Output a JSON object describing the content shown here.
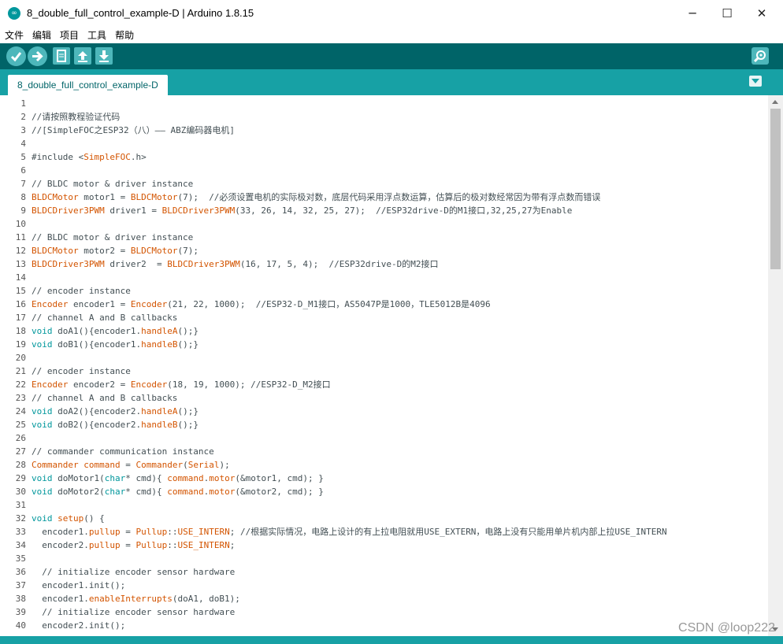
{
  "window": {
    "title": "8_double_full_control_example-D | Arduino 1.8.15",
    "app_icon": "∞",
    "minimize": "─",
    "maximize": "☐",
    "close": "✕"
  },
  "menu": [
    "文件",
    "编辑",
    "项目",
    "工具",
    "帮助"
  ],
  "toolbar": {
    "verify": "verify-icon",
    "upload": "upload-icon",
    "new": "new-file-icon",
    "open": "open-file-icon",
    "save": "save-file-icon",
    "serial_monitor": "serial-monitor-icon"
  },
  "tab": {
    "label": "8_double_full_control_example-D"
  },
  "watermark": "CSDN @loop222",
  "colors": {
    "toolbar": "#006468",
    "tabbar": "#17a1a5",
    "keyword": "#00979c",
    "type": "#d35400"
  },
  "code_lines": [
    {
      "n": "1",
      "parts": []
    },
    {
      "n": "2",
      "parts": [
        [
          "c",
          "//请按照教程验证代码"
        ]
      ]
    },
    {
      "n": "3",
      "parts": [
        [
          "c",
          "//[SimpleFOC之ESP32（八）—— ABZ编码器电机]"
        ]
      ]
    },
    {
      "n": "4",
      "parts": []
    },
    {
      "n": "5",
      "parts": [
        [
          "c",
          "#include <"
        ],
        [
          "t",
          "SimpleFOC"
        ],
        [
          "c",
          ".h>"
        ]
      ]
    },
    {
      "n": "6",
      "parts": []
    },
    {
      "n": "7",
      "parts": [
        [
          "c",
          "// BLDC motor & driver instance"
        ]
      ]
    },
    {
      "n": "8",
      "parts": [
        [
          "t",
          "BLDCMotor"
        ],
        [
          "c",
          " motor1 = "
        ],
        [
          "t",
          "BLDCMotor"
        ],
        [
          "c",
          "(7);  //必须设置电机的实际极对数，底层代码采用浮点数运算，估算后的极对数经常因为带有浮点数而错误"
        ]
      ]
    },
    {
      "n": "9",
      "parts": [
        [
          "t",
          "BLDCDriver3PWM"
        ],
        [
          "c",
          " driver1 = "
        ],
        [
          "t",
          "BLDCDriver3PWM"
        ],
        [
          "c",
          "(33, 26, 14, 32, 25, 27);  //ESP32drive-D的M1接口,32,25,27为Enable"
        ]
      ]
    },
    {
      "n": "10",
      "parts": []
    },
    {
      "n": "11",
      "parts": [
        [
          "c",
          "// BLDC motor & driver instance"
        ]
      ]
    },
    {
      "n": "12",
      "parts": [
        [
          "t",
          "BLDCMotor"
        ],
        [
          "c",
          " motor2 = "
        ],
        [
          "t",
          "BLDCMotor"
        ],
        [
          "c",
          "(7);"
        ]
      ]
    },
    {
      "n": "13",
      "parts": [
        [
          "t",
          "BLDCDriver3PWM"
        ],
        [
          "c",
          " driver2  = "
        ],
        [
          "t",
          "BLDCDriver3PWM"
        ],
        [
          "c",
          "(16, 17, 5, 4);  //ESP32drive-D的M2接口"
        ]
      ]
    },
    {
      "n": "14",
      "parts": []
    },
    {
      "n": "15",
      "parts": [
        [
          "c",
          "// encoder instance"
        ]
      ]
    },
    {
      "n": "16",
      "parts": [
        [
          "t",
          "Encoder"
        ],
        [
          "c",
          " encoder1 = "
        ],
        [
          "t",
          "Encoder"
        ],
        [
          "c",
          "(21, 22, 1000);  //ESP32-D_M1接口，AS5047P是1000，TLE5012B是4096"
        ]
      ]
    },
    {
      "n": "17",
      "parts": [
        [
          "c",
          "// channel A and B callbacks"
        ]
      ]
    },
    {
      "n": "18",
      "parts": [
        [
          "k",
          "void"
        ],
        [
          "c",
          " doA1(){encoder1."
        ],
        [
          "t",
          "handleA"
        ],
        [
          "c",
          "();}"
        ]
      ]
    },
    {
      "n": "19",
      "parts": [
        [
          "k",
          "void"
        ],
        [
          "c",
          " doB1(){encoder1."
        ],
        [
          "t",
          "handleB"
        ],
        [
          "c",
          "();}"
        ]
      ]
    },
    {
      "n": "20",
      "parts": []
    },
    {
      "n": "21",
      "parts": [
        [
          "c",
          "// encoder instance"
        ]
      ]
    },
    {
      "n": "22",
      "parts": [
        [
          "t",
          "Encoder"
        ],
        [
          "c",
          " encoder2 = "
        ],
        [
          "t",
          "Encoder"
        ],
        [
          "c",
          "(18, 19, 1000); //ESP32-D_M2接口"
        ]
      ]
    },
    {
      "n": "23",
      "parts": [
        [
          "c",
          "// channel A and B callbacks"
        ]
      ]
    },
    {
      "n": "24",
      "parts": [
        [
          "k",
          "void"
        ],
        [
          "c",
          " doA2(){encoder2."
        ],
        [
          "t",
          "handleA"
        ],
        [
          "c",
          "();}"
        ]
      ]
    },
    {
      "n": "25",
      "parts": [
        [
          "k",
          "void"
        ],
        [
          "c",
          " doB2(){encoder2."
        ],
        [
          "t",
          "handleB"
        ],
        [
          "c",
          "();}"
        ]
      ]
    },
    {
      "n": "26",
      "parts": []
    },
    {
      "n": "27",
      "parts": [
        [
          "c",
          "// commander communication instance"
        ]
      ]
    },
    {
      "n": "28",
      "parts": [
        [
          "t",
          "Commander"
        ],
        [
          "c",
          " "
        ],
        [
          "t",
          "command"
        ],
        [
          "c",
          " = "
        ],
        [
          "t",
          "Commander"
        ],
        [
          "c",
          "("
        ],
        [
          "t",
          "Serial"
        ],
        [
          "c",
          ");"
        ]
      ]
    },
    {
      "n": "29",
      "parts": [
        [
          "k",
          "void"
        ],
        [
          "c",
          " doMotor1("
        ],
        [
          "k",
          "char"
        ],
        [
          "c",
          "* cmd){ "
        ],
        [
          "t",
          "command"
        ],
        [
          "c",
          "."
        ],
        [
          "t",
          "motor"
        ],
        [
          "c",
          "(&motor1, cmd); }"
        ]
      ]
    },
    {
      "n": "30",
      "parts": [
        [
          "k",
          "void"
        ],
        [
          "c",
          " doMotor2("
        ],
        [
          "k",
          "char"
        ],
        [
          "c",
          "* cmd){ "
        ],
        [
          "t",
          "command"
        ],
        [
          "c",
          "."
        ],
        [
          "t",
          "motor"
        ],
        [
          "c",
          "(&motor2, cmd); }"
        ]
      ]
    },
    {
      "n": "31",
      "parts": []
    },
    {
      "n": "32",
      "parts": [
        [
          "k",
          "void"
        ],
        [
          "c",
          " "
        ],
        [
          "t",
          "setup"
        ],
        [
          "c",
          "() {"
        ]
      ]
    },
    {
      "n": "33",
      "parts": [
        [
          "c",
          "  encoder1."
        ],
        [
          "t",
          "pullup"
        ],
        [
          "c",
          " = "
        ],
        [
          "t",
          "Pullup"
        ],
        [
          "c",
          "::"
        ],
        [
          "t",
          "USE_INTERN"
        ],
        [
          "c",
          "; //根据实际情况，电路上设计的有上拉电阻就用USE_EXTERN，电路上没有只能用单片机内部上拉USE_INTERN"
        ]
      ]
    },
    {
      "n": "34",
      "parts": [
        [
          "c",
          "  encoder2."
        ],
        [
          "t",
          "pullup"
        ],
        [
          "c",
          " = "
        ],
        [
          "t",
          "Pullup"
        ],
        [
          "c",
          "::"
        ],
        [
          "t",
          "USE_INTERN"
        ],
        [
          "c",
          ";"
        ]
      ]
    },
    {
      "n": "35",
      "parts": []
    },
    {
      "n": "36",
      "parts": [
        [
          "c",
          "  // initialize encoder sensor hardware"
        ]
      ]
    },
    {
      "n": "37",
      "parts": [
        [
          "c",
          "  encoder1.init();"
        ]
      ]
    },
    {
      "n": "38",
      "parts": [
        [
          "c",
          "  encoder1."
        ],
        [
          "t",
          "enableInterrupts"
        ],
        [
          "c",
          "(doA1, doB1);"
        ]
      ]
    },
    {
      "n": "39",
      "parts": [
        [
          "c",
          "  // initialize encoder sensor hardware"
        ]
      ]
    },
    {
      "n": "40",
      "parts": [
        [
          "c",
          "  encoder2.init();"
        ]
      ]
    }
  ]
}
